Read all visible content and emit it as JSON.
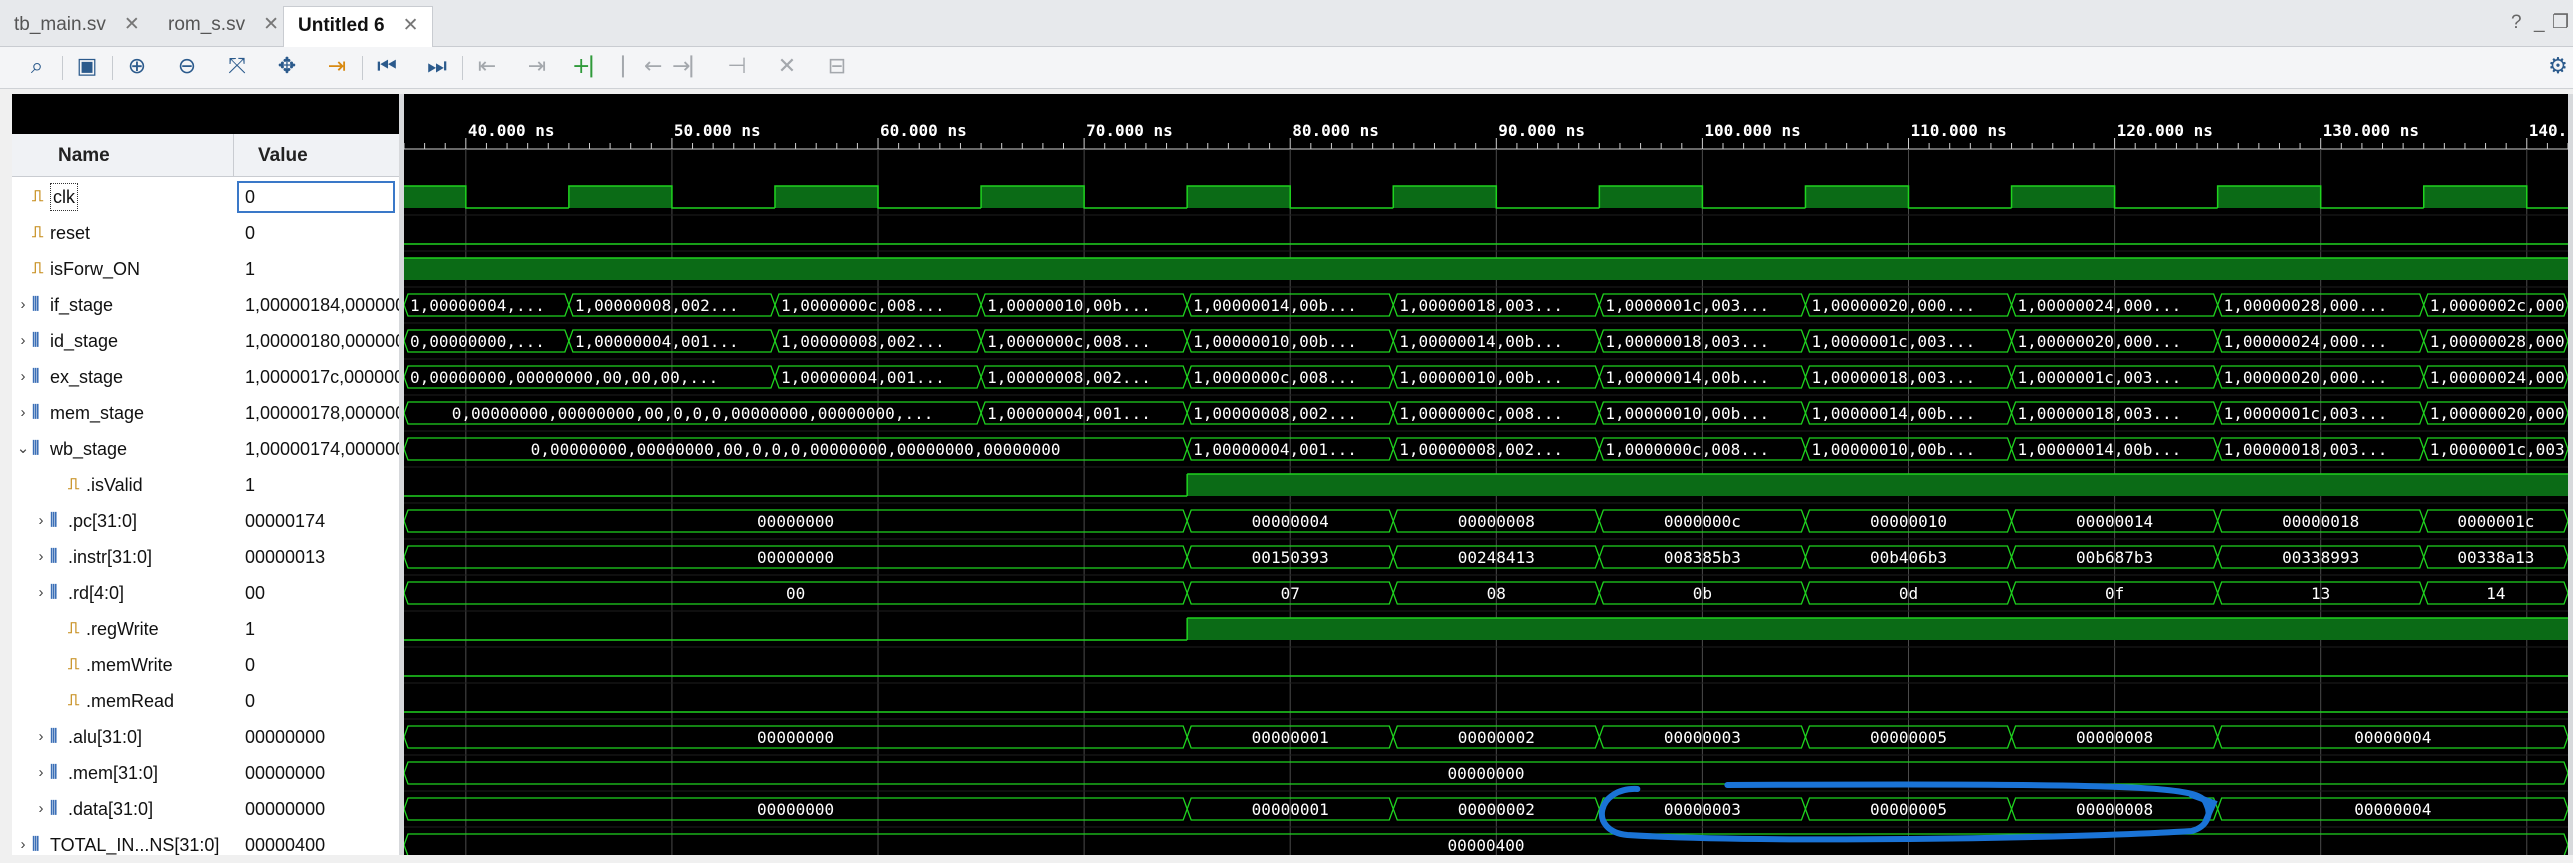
{
  "tabs": [
    {
      "label": "tb_main.sv",
      "close": "✕"
    },
    {
      "label": "rom_s.sv",
      "close": "✕"
    },
    {
      "label": "Untitled 6",
      "close": "✕"
    }
  ],
  "window_controls": {
    "help": "?",
    "minimize": "_",
    "restore": "❐"
  },
  "toolbar_icons": [
    "search-icon",
    "save-icon",
    "zoom-in-icon",
    "zoom-out-icon",
    "zoom-fit-icon",
    "cursor-icon",
    "marker-icon",
    "go-to-start-icon",
    "go-to-end-icon",
    "previous-edge-icon",
    "next-edge-icon",
    "add-marker-icon",
    "previous-marker-icon",
    "next-marker-icon",
    "swap-cursors-icon",
    "delete-icon",
    "snap-icon",
    "settings-icon"
  ],
  "columns": {
    "name": "Name",
    "value": "Value"
  },
  "signals": [
    {
      "name": "clk",
      "value": "0",
      "kind": "bit",
      "expand": "",
      "indent": 0,
      "selected": true
    },
    {
      "name": "reset",
      "value": "0",
      "kind": "bit",
      "expand": "",
      "indent": 0
    },
    {
      "name": "isForw_ON",
      "value": "1",
      "kind": "bit",
      "expand": "",
      "indent": 0
    },
    {
      "name": "if_stage",
      "value": "1,00000184,000000",
      "kind": "bus",
      "expand": "›",
      "indent": 0
    },
    {
      "name": "id_stage",
      "value": "1,00000180,000000",
      "kind": "bus",
      "expand": "›",
      "indent": 0
    },
    {
      "name": "ex_stage",
      "value": "1,0000017c,000000",
      "kind": "bus",
      "expand": "›",
      "indent": 0
    },
    {
      "name": "mem_stage",
      "value": "1,00000178,000000",
      "kind": "bus",
      "expand": "›",
      "indent": 0
    },
    {
      "name": "wb_stage",
      "value": "1,00000174,000000",
      "kind": "bus",
      "expand": "⌄",
      "indent": 0
    },
    {
      "name": ".isValid",
      "value": "1",
      "kind": "bit",
      "expand": "",
      "indent": 2
    },
    {
      "name": ".pc[31:0]",
      "value": "00000174",
      "kind": "bus",
      "expand": "›",
      "indent": 1
    },
    {
      "name": ".instr[31:0]",
      "value": "00000013",
      "kind": "bus",
      "expand": "›",
      "indent": 1
    },
    {
      "name": ".rd[4:0]",
      "value": "00",
      "kind": "bus",
      "expand": "›",
      "indent": 1
    },
    {
      "name": ".regWrite",
      "value": "1",
      "kind": "bit",
      "expand": "",
      "indent": 2
    },
    {
      "name": ".memWrite",
      "value": "0",
      "kind": "bit",
      "expand": "",
      "indent": 2
    },
    {
      "name": ".memRead",
      "value": "0",
      "kind": "bit",
      "expand": "",
      "indent": 2
    },
    {
      "name": ".alu[31:0]",
      "value": "00000000",
      "kind": "bus",
      "expand": "›",
      "indent": 1
    },
    {
      "name": ".mem[31:0]",
      "value": "00000000",
      "kind": "bus",
      "expand": "›",
      "indent": 1
    },
    {
      "name": ".data[31:0]",
      "value": "00000000",
      "kind": "bus",
      "expand": "›",
      "indent": 1
    },
    {
      "name": "TOTAL_IN...NS[31:0]",
      "value": "00000400",
      "kind": "bus",
      "expand": "›",
      "indent": 0
    }
  ],
  "time_ruler": {
    "unit": "ns",
    "labels": [
      "40.000 ns",
      "50.000 ns",
      "60.000 ns",
      "70.000 ns",
      "80.000 ns",
      "90.000 ns",
      "100.000 ns",
      "110.000 ns",
      "120.000 ns",
      "130.000 ns",
      "140.000 ns"
    ],
    "ticks_ns": [
      40,
      50,
      60,
      70,
      80,
      90,
      100,
      110,
      120,
      130,
      140
    ],
    "view_start_ns": 37,
    "view_end_ns": 142
  },
  "waveforms": [
    {
      "type": "clock",
      "period_ns": 10,
      "high_start_ns": 35
    },
    {
      "type": "bit",
      "changes": [
        [
          37,
          0
        ]
      ]
    },
    {
      "type": "bit",
      "changes": [
        [
          37,
          1
        ]
      ]
    },
    {
      "type": "bus",
      "segments": [
        [
          37,
          "1,00000004,..."
        ],
        [
          45,
          "1,00000008,002..."
        ],
        [
          55,
          "1,0000000c,008..."
        ],
        [
          65,
          "1,00000010,00b..."
        ],
        [
          75,
          "1,00000014,00b..."
        ],
        [
          85,
          "1,00000018,003..."
        ],
        [
          95,
          "1,0000001c,003..."
        ],
        [
          105,
          "1,00000020,000..."
        ],
        [
          115,
          "1,00000024,000..."
        ],
        [
          125,
          "1,00000028,000..."
        ],
        [
          135,
          "1,0000002c,000..."
        ]
      ]
    },
    {
      "type": "bus",
      "segments": [
        [
          37,
          "0,00000000,..."
        ],
        [
          45,
          "1,00000004,001..."
        ],
        [
          55,
          "1,00000008,002..."
        ],
        [
          65,
          "1,0000000c,008..."
        ],
        [
          75,
          "1,00000010,00b..."
        ],
        [
          85,
          "1,00000014,00b..."
        ],
        [
          95,
          "1,00000018,003..."
        ],
        [
          105,
          "1,0000001c,003..."
        ],
        [
          115,
          "1,00000020,000..."
        ],
        [
          125,
          "1,00000024,000..."
        ],
        [
          135,
          "1,00000028,000..."
        ]
      ]
    },
    {
      "type": "bus",
      "segments": [
        [
          37,
          "0,00000000,00000000,00,00,00,..."
        ],
        [
          55,
          "1,00000004,001..."
        ],
        [
          65,
          "1,00000008,002..."
        ],
        [
          75,
          "1,0000000c,008..."
        ],
        [
          85,
          "1,00000010,00b..."
        ],
        [
          95,
          "1,00000014,00b..."
        ],
        [
          105,
          "1,00000018,003..."
        ],
        [
          115,
          "1,0000001c,003..."
        ],
        [
          125,
          "1,00000020,000..."
        ],
        [
          135,
          "1,00000024,000..."
        ]
      ]
    },
    {
      "type": "bus",
      "segments": [
        [
          37,
          "0,00000000,00000000,00,0,0,0,00000000,00000000,..."
        ],
        [
          65,
          "1,00000004,001..."
        ],
        [
          75,
          "1,00000008,002..."
        ],
        [
          85,
          "1,0000000c,008..."
        ],
        [
          95,
          "1,00000010,00b..."
        ],
        [
          105,
          "1,00000014,00b..."
        ],
        [
          115,
          "1,00000018,003..."
        ],
        [
          125,
          "1,0000001c,003..."
        ],
        [
          135,
          "1,00000020,000..."
        ]
      ]
    },
    {
      "type": "bus",
      "segments": [
        [
          37,
          "0,00000000,00000000,00,0,0,0,00000000,00000000,00000000"
        ],
        [
          75,
          "1,00000004,001..."
        ],
        [
          85,
          "1,00000008,002..."
        ],
        [
          95,
          "1,0000000c,008..."
        ],
        [
          105,
          "1,00000010,00b..."
        ],
        [
          115,
          "1,00000014,00b..."
        ],
        [
          125,
          "1,00000018,003..."
        ],
        [
          135,
          "1,0000001c,003..."
        ]
      ]
    },
    {
      "type": "bit",
      "changes": [
        [
          37,
          0
        ],
        [
          75,
          1
        ]
      ]
    },
    {
      "type": "bus",
      "segments": [
        [
          37,
          "00000000"
        ],
        [
          75,
          "00000004"
        ],
        [
          85,
          "00000008"
        ],
        [
          95,
          "0000000c"
        ],
        [
          105,
          "00000010"
        ],
        [
          115,
          "00000014"
        ],
        [
          125,
          "00000018"
        ],
        [
          135,
          "0000001c"
        ]
      ]
    },
    {
      "type": "bus",
      "segments": [
        [
          37,
          "00000000"
        ],
        [
          75,
          "00150393"
        ],
        [
          85,
          "00248413"
        ],
        [
          95,
          "008385b3"
        ],
        [
          105,
          "00b406b3"
        ],
        [
          115,
          "00b687b3"
        ],
        [
          125,
          "00338993"
        ],
        [
          135,
          "00338a13"
        ]
      ]
    },
    {
      "type": "bus",
      "segments": [
        [
          37,
          "00"
        ],
        [
          75,
          "07"
        ],
        [
          85,
          "08"
        ],
        [
          95,
          "0b"
        ],
        [
          105,
          "0d"
        ],
        [
          115,
          "0f"
        ],
        [
          125,
          "13"
        ],
        [
          135,
          "14"
        ]
      ]
    },
    {
      "type": "bit",
      "changes": [
        [
          37,
          0
        ],
        [
          75,
          1
        ]
      ]
    },
    {
      "type": "bit",
      "changes": [
        [
          37,
          0
        ]
      ]
    },
    {
      "type": "bit",
      "changes": [
        [
          37,
          0
        ]
      ]
    },
    {
      "type": "bus",
      "segments": [
        [
          37,
          "00000000"
        ],
        [
          75,
          "00000001"
        ],
        [
          85,
          "00000002"
        ],
        [
          95,
          "00000003"
        ],
        [
          105,
          "00000005"
        ],
        [
          115,
          "00000008"
        ],
        [
          125,
          "00000004"
        ]
      ]
    },
    {
      "type": "bus",
      "segments": [
        [
          37,
          "00000000"
        ]
      ]
    },
    {
      "type": "bus",
      "segments": [
        [
          37,
          "00000000"
        ],
        [
          75,
          "00000001"
        ],
        [
          85,
          "00000002"
        ],
        [
          95,
          "00000003"
        ],
        [
          105,
          "00000005"
        ],
        [
          115,
          "00000008"
        ],
        [
          125,
          "00000004"
        ]
      ]
    },
    {
      "type": "bus",
      "segments": [
        [
          37,
          "00000400"
        ]
      ]
    }
  ],
  "colors": {
    "wave": "#1fd31f",
    "fill": "#0b6b16",
    "grid": "#4a4a4a",
    "background": "#000000",
    "annotation": "#1a73d6"
  }
}
